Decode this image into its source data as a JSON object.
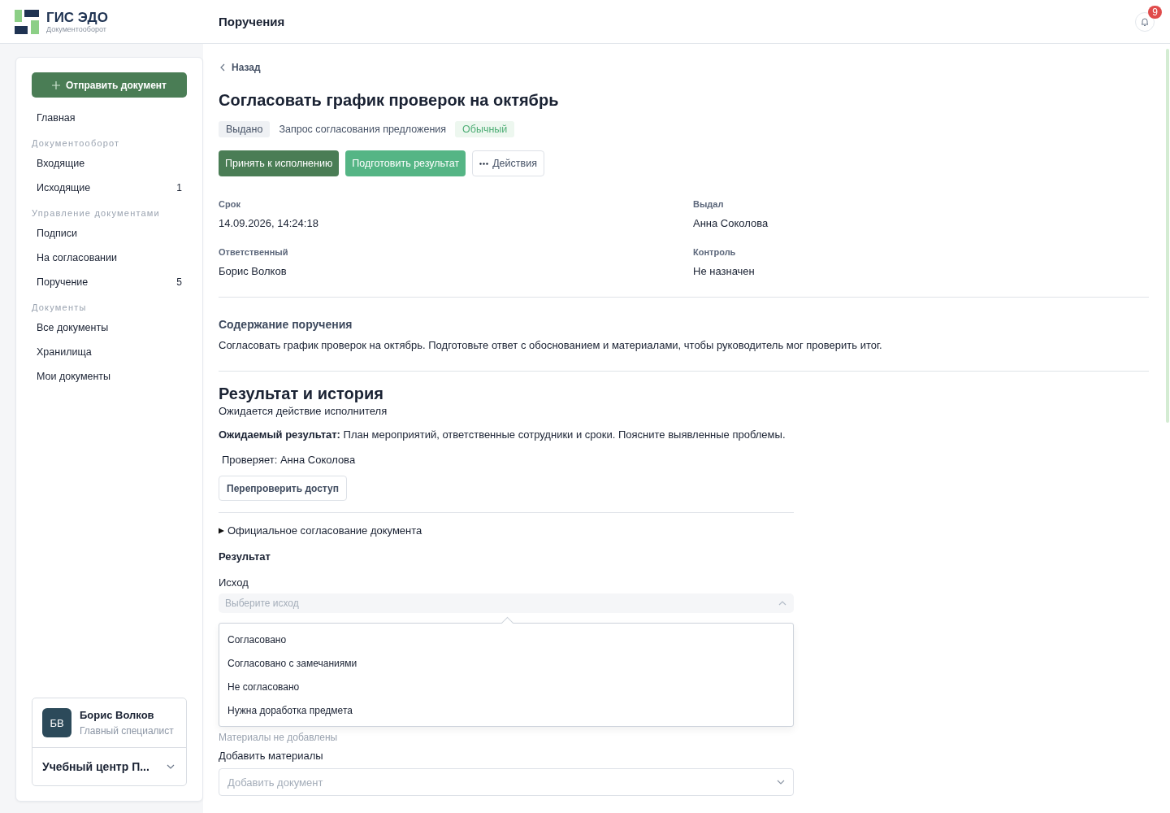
{
  "app": {
    "name": "ГИС ЭДО",
    "subtitle": "Документооборот"
  },
  "header": {
    "title": "Поручения",
    "notifications": "9"
  },
  "sidebar": {
    "send_button": "Отправить документ",
    "sections": [
      {
        "items": [
          {
            "label": "Главная",
            "selected": false
          }
        ]
      },
      {
        "heading": "Документооборот",
        "items": [
          {
            "label": "Входящие",
            "selected": false
          },
          {
            "label": "Исходящие",
            "count": "1",
            "selected": false
          }
        ]
      },
      {
        "heading": "Управление документами",
        "items": [
          {
            "label": "Подписи",
            "selected": false
          },
          {
            "label": "На согласовании",
            "selected": false
          },
          {
            "label": "Поручение",
            "count": "5",
            "selected": false
          }
        ]
      },
      {
        "heading": "Документы",
        "items": [
          {
            "label": "Все документы",
            "selected": false
          },
          {
            "label": "Хранилища",
            "selected": false
          },
          {
            "label": "Мои документы",
            "selected": false
          }
        ]
      }
    ],
    "user": {
      "initials": "БВ",
      "name": "Борис Волков",
      "role": "Главный специалист",
      "organization": "Учебный центр П..."
    }
  },
  "task": {
    "back": "Назад",
    "title": "Согласовать график проверок на октябрь",
    "tags": [
      {
        "text": "Выдано",
        "kind": "status"
      },
      {
        "text": "Запрос согласования предложения",
        "kind": "plain"
      },
      {
        "text": "Обычный",
        "kind": "priority"
      }
    ],
    "actions": [
      {
        "label": "Принять к исполнению",
        "kind": "primary"
      },
      {
        "label": "Подготовить результат",
        "kind": "secondary"
      },
      {
        "label": "Действия",
        "kind": "menu"
      }
    ],
    "fields": [
      {
        "label": "Срок",
        "value": "14.09.2026, 14:24:18"
      },
      {
        "label": "Выдал",
        "value": "Анна Соколова"
      },
      {
        "label": "Ответственный",
        "value": "Борис Волков"
      },
      {
        "label": "Контроль",
        "value": "Не назначен"
      }
    ],
    "content_heading": "Содержание поручения",
    "content": "Согласовать график проверок на октябрь. Подготовьте ответ с обоснованием и материалами, чтобы руководитель мог проверить итог."
  },
  "result": {
    "heading": "Результат и история",
    "status": "Ожидается действие исполнителя",
    "expected": "**Ожидаемый результат:** План мероприятий, ответственные сотрудники и сроки. Поясните выявленные проблемы.",
    "reviewer": "Проверяет: Анна Соколова",
    "recheck_button": "Перепроверить доступ",
    "approval_toggle": {
      "label": "Официальное согласование документа",
      "expanded": false
    },
    "form_heading": "Результат",
    "outcome_label": "Исход",
    "outcome_placeholder": "Выберите исход",
    "outcome_open": true,
    "outcome_options": [
      "Согласовано",
      "Согласовано с замечаниями",
      "Не согласовано",
      "Нужна доработка предмета"
    ],
    "materials_empty": "Материалы не добавлены",
    "materials_label": "Добавить материалы",
    "materials_placeholder": "Добавить документ"
  }
}
